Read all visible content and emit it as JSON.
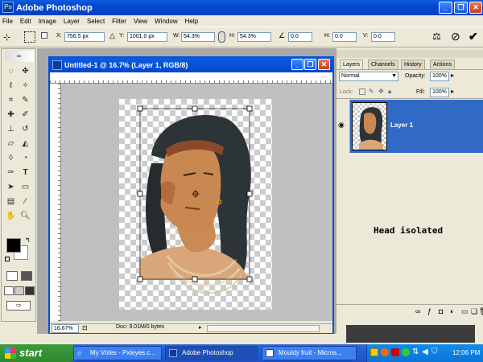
{
  "app": {
    "title": "Adobe Photoshop",
    "icon_text": "Ps"
  },
  "menu": [
    "File",
    "Edit",
    "Image",
    "Layer",
    "Select",
    "Filter",
    "View",
    "Window",
    "Help"
  ],
  "options": {
    "x_label": "X:",
    "x_value": "756.5 px",
    "y_label": "Y:",
    "y_value": "1001.0 px",
    "w_label": "W:",
    "w_value": "54.3%",
    "h_label": "H:",
    "h_value": "54.3%",
    "angle_value": "0.0",
    "hskew_label": "H:",
    "hskew_value": "0.0",
    "vskew_label": "V:",
    "vskew_value": "0.0"
  },
  "document": {
    "title": "Untitled-1 @ 16.7% (Layer 1, RGB/8)",
    "zoom": "16.67%",
    "doc_info": "Doc: 9.01M/0 bytes"
  },
  "panel": {
    "tabs": [
      "Layers",
      "Channels",
      "History",
      "Actions"
    ],
    "blend_mode": "Normal",
    "opacity_label": "Opacity:",
    "opacity_value": "100%",
    "lock_label": "Lock:",
    "fill_label": "Fill:",
    "fill_value": "100%",
    "layer_name": "Layer 1",
    "annotation": "Head isolated"
  },
  "taskbar": {
    "start": "start",
    "tasks": [
      "My Votes - Pxleyes.c...",
      "Adobe Photoshop",
      "Mouldy fruit - Micros..."
    ],
    "clock": "12:06 PM"
  }
}
